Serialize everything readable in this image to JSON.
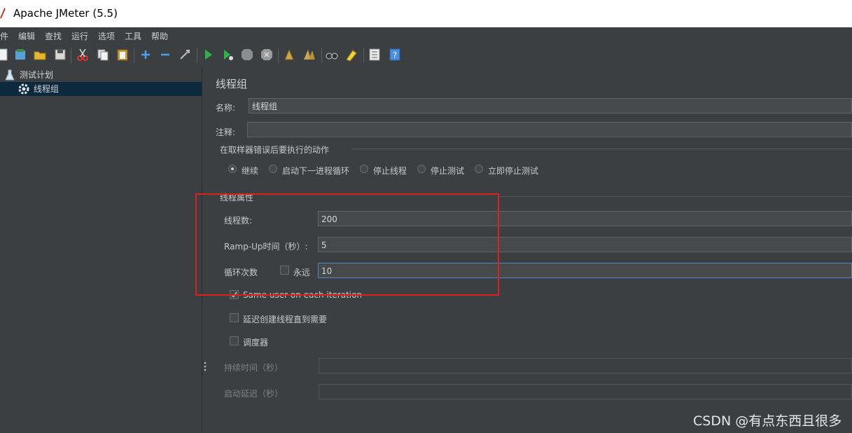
{
  "window": {
    "title": "Apache JMeter (5.5)"
  },
  "menu": [
    "件",
    "编辑",
    "查找",
    "运行",
    "选项",
    "工具",
    "帮助"
  ],
  "toolbar": {
    "icons": [
      "new-icon",
      "templates-icon",
      "open-icon",
      "save-icon",
      "cut-icon",
      "copy-icon",
      "paste-icon",
      "expand-icon",
      "collapse-icon",
      "toggle-icon",
      "start-icon",
      "start-no-pause-icon",
      "stop-icon",
      "shutdown-icon",
      "clear-icon",
      "clear-all-icon",
      "search-icon",
      "reset-search-icon",
      "function-helper-icon",
      "help-icon"
    ]
  },
  "tree": {
    "items": [
      {
        "label": "测试计划",
        "icon": "flask-icon"
      },
      {
        "label": "线程组",
        "icon": "gear-icon"
      }
    ]
  },
  "panel": {
    "heading": "线程组",
    "name_label": "名称:",
    "name_value": "线程组",
    "comment_label": "注释:",
    "comment_value": "",
    "error_action": {
      "title": "在取样器错误后要执行的动作",
      "options": [
        "继续",
        "启动下一进程循环",
        "停止线程",
        "停止测试",
        "立即停止测试"
      ],
      "selected": 0
    },
    "thread_props": {
      "title": "线程属性",
      "threads_label": "线程数:",
      "threads_value": "200",
      "rampup_label": "Ramp-Up时间（秒）:",
      "rampup_value": "5",
      "loop_label": "循环次数",
      "forever_label": "永远",
      "loop_value": "10",
      "same_user_label": "Same user on each iteration",
      "delay_label": "延迟创建线程直到需要",
      "scheduler_label": "调度器",
      "duration_label": "持续时间（秒）",
      "startup_delay_label": "启动延迟（秒）"
    }
  },
  "watermark": "CSDN @有点东西且很多"
}
